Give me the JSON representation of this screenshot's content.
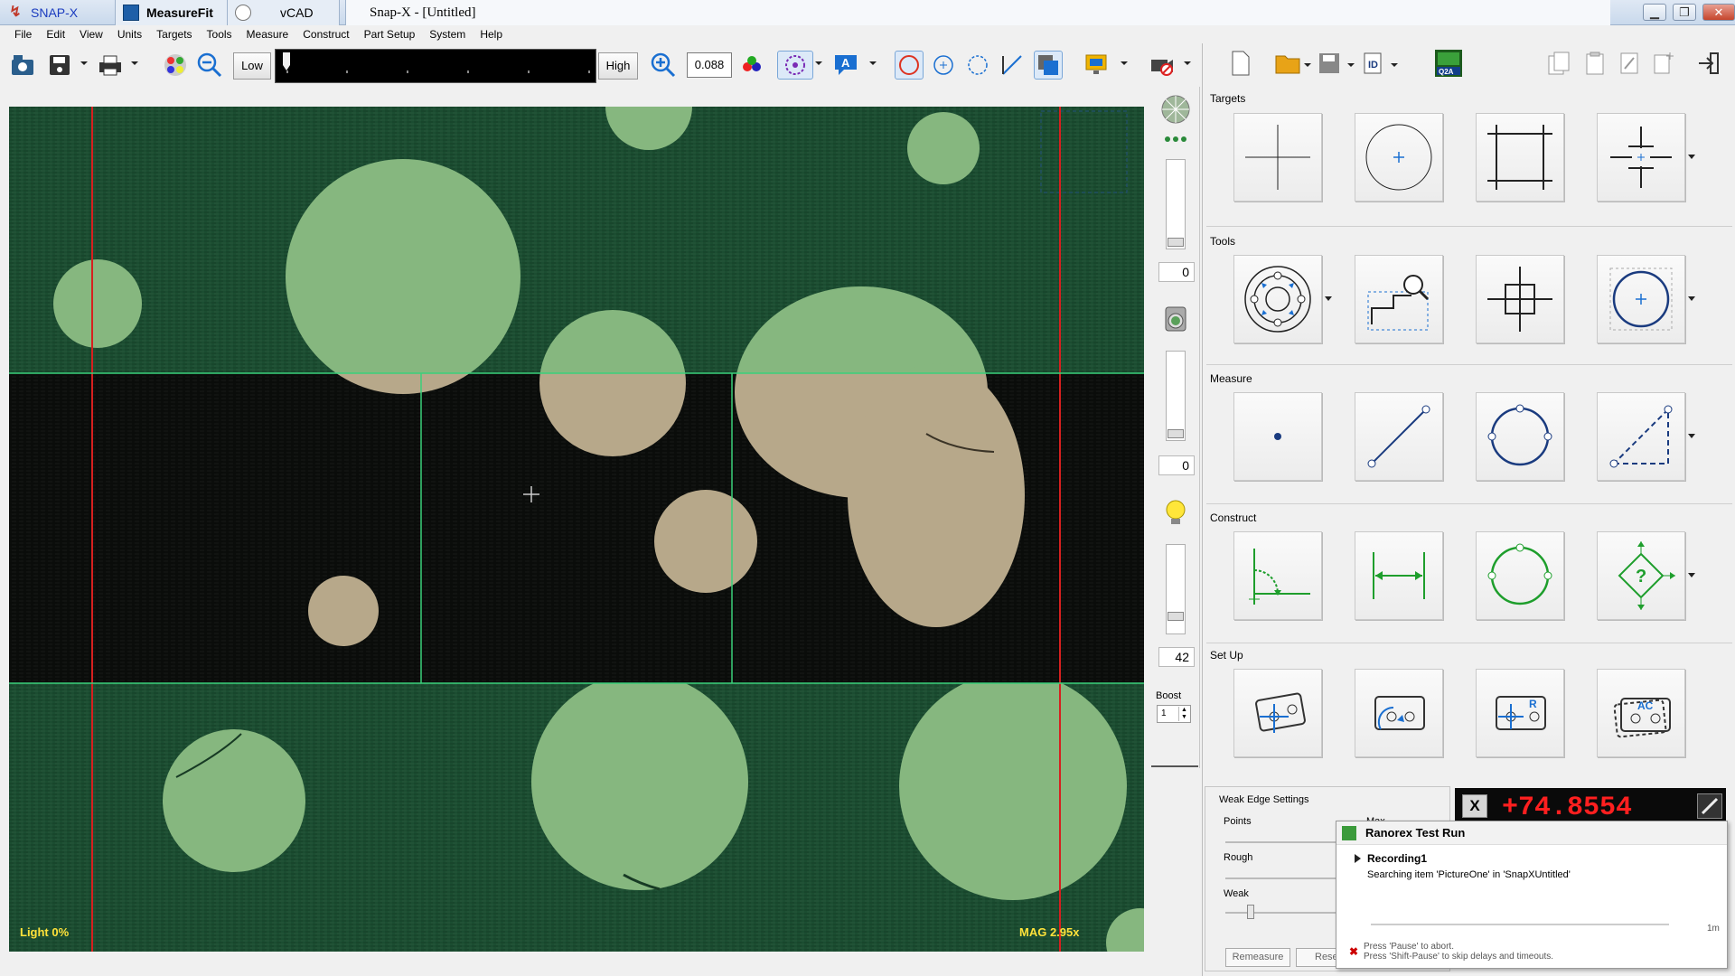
{
  "titlebar": {
    "tabs": [
      {
        "label": "SNAP-X"
      },
      {
        "label": "MeasureFit"
      },
      {
        "label": "vCAD"
      }
    ],
    "document_title": "Snap-X - [Untitled]"
  },
  "menu": [
    "File",
    "Edit",
    "View",
    "Units",
    "Targets",
    "Tools",
    "Measure",
    "Construct",
    "Part Setup",
    "System",
    "Help"
  ],
  "toolbar": {
    "low_label": "Low",
    "high_label": "High",
    "zoom_value": "0.088"
  },
  "camera": {
    "light_label": "Light   0%",
    "mag_label": "MAG 2.95x"
  },
  "side_controls": {
    "slider1_value": "0",
    "slider2_value": "0",
    "slider3_value": "42",
    "boost_label": "Boost",
    "boost_value": "1"
  },
  "panel": {
    "sections": {
      "targets": "Targets",
      "tools": "Tools",
      "measure": "Measure",
      "construct": "Construct",
      "setup": "Set Up"
    }
  },
  "weak_edge": {
    "title": "Weak Edge Settings",
    "points_label": "Points",
    "max_label": "Max",
    "rough_label": "Rough",
    "weak_label": "Weak",
    "weak_level": 0.2,
    "remeasure_label": "Remeasure",
    "reset_label": "Rese"
  },
  "dro": {
    "value": "+74.8554"
  },
  "ranorex": {
    "title": "Ranorex Test Run",
    "recording": "Recording1",
    "status": "Searching item 'PictureOne' in 'SnapXUntitled'",
    "time": "1m",
    "hint1": "Press 'Pause' to abort.",
    "hint2": "Press 'Shift-Pause' to skip delays and timeouts."
  },
  "colors": {
    "accent_blue": "#1a6fd1",
    "construct_green": "#1e9e2c",
    "dro_red": "#ff1f1f",
    "overlay_yellow": "#ffe23a"
  }
}
